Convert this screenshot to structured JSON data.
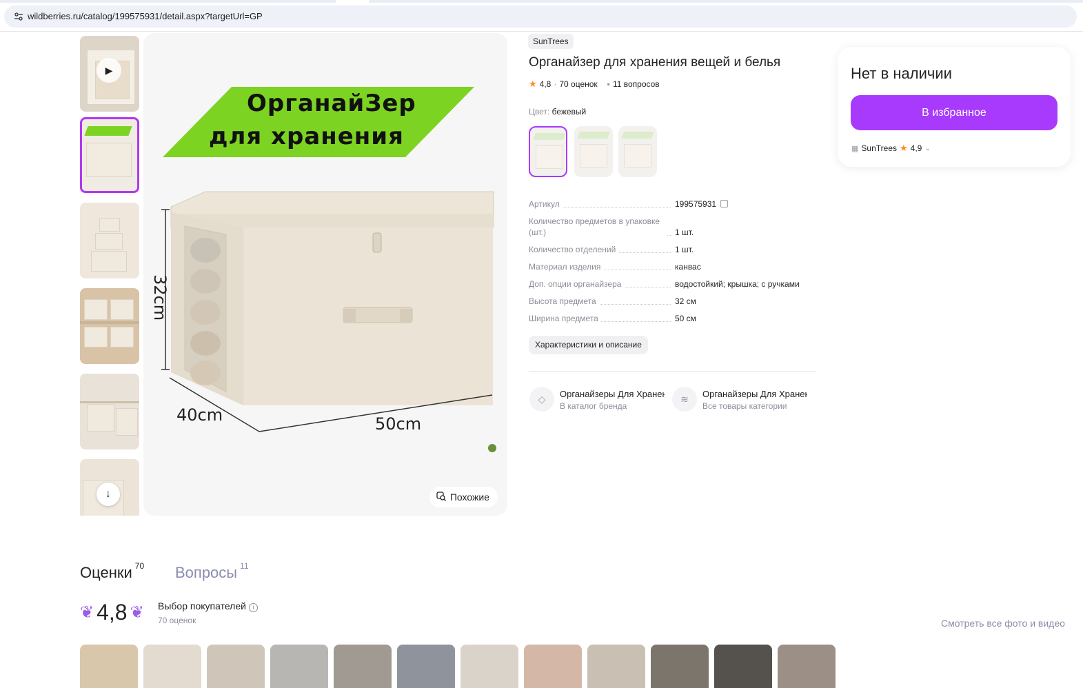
{
  "browser": {
    "url": "wildberries.ru/catalog/199575931/detail.aspx?targetUrl=GP"
  },
  "gallery": {
    "banner_line1": "ОрганайЗер",
    "banner_line2": "для хранения",
    "dim_height": "32cm",
    "dim_depth": "40cm",
    "dim_width": "50cm",
    "similar_label": "Похожие"
  },
  "product": {
    "brand": "SunTrees",
    "title": "Органайзер для хранения вещей и белья",
    "rating": "4,8",
    "reviews_count": "70 оценок",
    "questions_count": "11 вопросов",
    "color_key": "Цвет:",
    "color_value": "бежевый"
  },
  "specs": [
    {
      "key": "Артикул",
      "value": "199575931"
    },
    {
      "key": "Количество предметов в упаковке (шт.)",
      "value": "1 шт."
    },
    {
      "key": "Количество отделений",
      "value": "1 шт."
    },
    {
      "key": "Материал изделия",
      "value": "канвас"
    },
    {
      "key": "Доп. опции органайзера",
      "value": "водостойкий; крышка; с ручками"
    },
    {
      "key": "Высота предмета",
      "value": "32 см"
    },
    {
      "key": "Ширина предмета",
      "value": "50 см"
    }
  ],
  "description_button": "Характеристики и описание",
  "brand_links": [
    {
      "title": "Органайзеры Для Хранения",
      "subtitle": "В каталог бренда"
    },
    {
      "title": "Органайзеры Для Хранения",
      "subtitle": "Все товары категории"
    }
  ],
  "buy_card": {
    "status": "Нет в наличии",
    "favorite_button": "В избранное",
    "seller_name": "SunTrees",
    "seller_rating": "4,9"
  },
  "reviews": {
    "tab_reviews": "Оценки",
    "tab_reviews_count": "70",
    "tab_questions": "Вопросы",
    "tab_questions_count": "11",
    "rating": "4,8",
    "badge": "Выбор покупателей",
    "count": "70 оценок",
    "see_all": "Смотреть все фото и видео"
  },
  "colors": {
    "accent": "#a73afd",
    "star": "#ff8c1a",
    "banner_green": "#7dd322"
  }
}
